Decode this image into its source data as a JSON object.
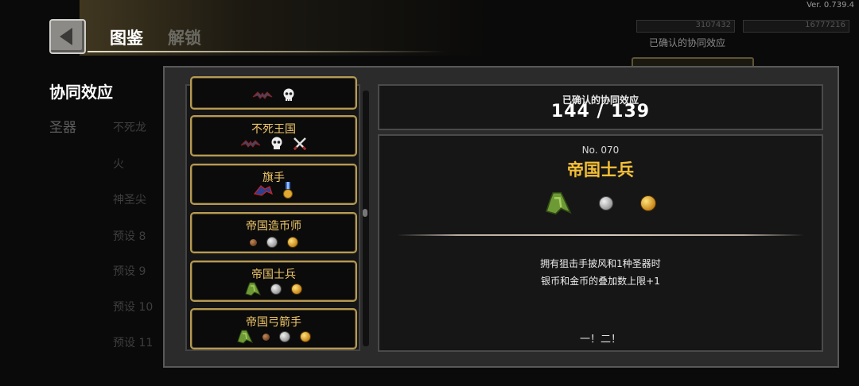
{
  "version": "Ver. 0.739.4",
  "header": {
    "title": "图鉴",
    "faded_tab": "解锁"
  },
  "sidebar": {
    "active_tab": "协同效应",
    "inactive_tab": "圣器"
  },
  "background": {
    "currency_1": "3107432",
    "currency_2": "16777216",
    "confirmed_label": "已确认的协同效应",
    "list": [
      "不死龙",
      "火",
      "神圣尖",
      "预设 8",
      "预设 9",
      "预设 10",
      "预设 11"
    ]
  },
  "count_panel": {
    "label": "已确认的协同效应",
    "value": "144 / 139"
  },
  "synergy_list": [
    {
      "name": "",
      "icons": [
        "bat-icon",
        "skull-icon"
      ]
    },
    {
      "name": "不死王国",
      "icons": [
        "bat-icon",
        "skull-icon",
        "crossed-swords-icon"
      ]
    },
    {
      "name": "旗手",
      "icons": [
        "banner-icon",
        "medal-icon"
      ]
    },
    {
      "name": "帝国造币师",
      "icons": [
        "copper-coin-icon",
        "silver-coin-icon",
        "gold-coin-icon"
      ]
    },
    {
      "name": "帝国士兵",
      "icons": [
        "sniper-cloak-icon",
        "silver-coin-icon",
        "gold-coin-icon"
      ]
    },
    {
      "name": "帝国弓箭手",
      "icons": [
        "sniper-cloak-icon",
        "copper-coin-icon",
        "silver-coin-icon",
        "gold-coin-icon"
      ]
    }
  ],
  "detail": {
    "number": "No. 070",
    "name": "帝国士兵",
    "icons": [
      "sniper-cloak-icon",
      "silver-coin-icon",
      "gold-coin-icon"
    ],
    "description_line1": "拥有狙击手披风和1种圣器时",
    "description_line2": "银币和金币的叠加数上限+1",
    "quote": "一！二！"
  },
  "colors": {
    "accent_gold": "#f5c038",
    "card_border": "#b79a53",
    "card_title": "#f1c86a"
  }
}
